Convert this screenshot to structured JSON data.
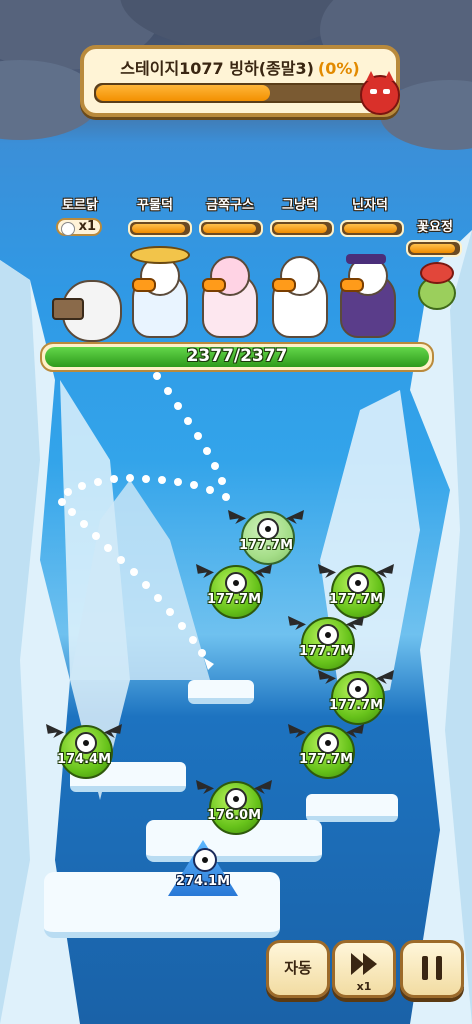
{
  "stage": {
    "title": "스테이지1077 빙하(종말3)",
    "progress_text": "(0%)",
    "progress_fraction": 0.64,
    "boss_icon": "red-devil-icon"
  },
  "heroes": [
    {
      "name": "토르닭",
      "counter": "x1"
    },
    {
      "name": "꾸물덕",
      "bar_fraction": 0.95
    },
    {
      "name": "금쪽구스",
      "bar_fraction": 0.95
    },
    {
      "name": "그냥덕",
      "bar_fraction": 0.95
    },
    {
      "name": "닌자덕",
      "bar_fraction": 0.95
    },
    {
      "name": "꽃요정",
      "bar_fraction": 0.95
    }
  ],
  "team_hp": {
    "text": "2377/2377",
    "fraction": 1.0
  },
  "monsters": [
    {
      "hp": "177.7M",
      "faded": true
    },
    {
      "hp": "177.7M",
      "faded": false
    },
    {
      "hp": "177.7M",
      "faded": false
    },
    {
      "hp": "177.7M",
      "faded": false
    },
    {
      "hp": "177.7M",
      "faded": false
    },
    {
      "hp": "174.4M",
      "faded": false
    },
    {
      "hp": "177.7M",
      "faded": false
    },
    {
      "hp": "176.0M",
      "faded": false
    }
  ],
  "boss": {
    "hp": "274.1M"
  },
  "controls": {
    "auto_label": "자동",
    "speed_label": "x1",
    "speed_icon": "fast-forward-icon",
    "pause_icon": "pause-icon"
  }
}
